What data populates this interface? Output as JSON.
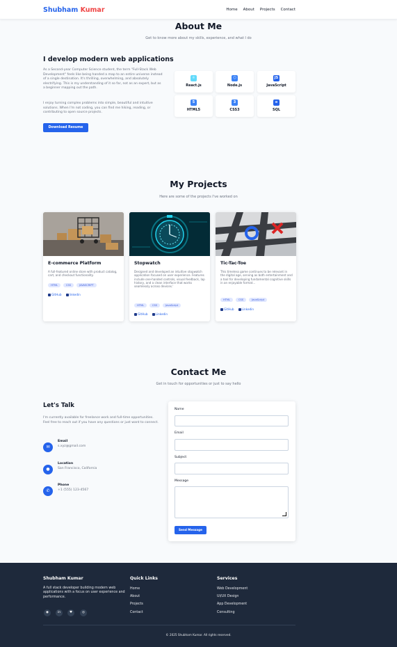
{
  "nav": {
    "logo_first": "Shubham",
    "logo_last": "Kumar",
    "links": [
      "Home",
      "About",
      "Projects",
      "Contact"
    ]
  },
  "about": {
    "title": "About Me",
    "subtitle": "Get to know more about my skills, experience, and what I do",
    "heading": "I develop modern web applications",
    "para1": "As a Second-year Computer Science student, the term \"Full-Stack Web Development\" feels like being handed a map to an entire universe instead of a single destination. It's thrilling, overwhelming, and absolutely electrifying. This is my understanding of it so far, not as an expert, but as a beginner mapping out the path.",
    "para2": "I enjoy turning complex problems into simple, beautiful and intuitive solutions. When I'm not coding, you can find me hiking, reading, or contributing to open source projects.",
    "resume_button": "Download Resume",
    "skills": [
      {
        "name": "React.js",
        "icon": "react-icon",
        "glyph": "⚛",
        "color": "#61dafb"
      },
      {
        "name": "Node.js",
        "icon": "nodejs-icon",
        "glyph": "⬡",
        "color": "#3b82f6"
      },
      {
        "name": "JavaScript",
        "icon": "javascript-icon",
        "glyph": "JS",
        "color": "#2563eb"
      },
      {
        "name": "HTML5",
        "icon": "html5-icon",
        "glyph": "5",
        "color": "#3b82f6"
      },
      {
        "name": "CSS3",
        "icon": "css3-icon",
        "glyph": "3",
        "color": "#3b82f6"
      },
      {
        "name": "SQL",
        "icon": "database-icon",
        "glyph": "≡",
        "color": "#2563eb"
      }
    ]
  },
  "projects": {
    "title": "My Projects",
    "subtitle": "Here are some of the projects I've worked on",
    "items": [
      {
        "title": "E-commerce Platform",
        "desc": "A full-featured online store with product catalog, cart, and checkout functionality.",
        "tags": [
          "HTML",
          "CSS",
          "JAVASCRIPT"
        ],
        "github": "GitHub",
        "linkedin": "linkedin"
      },
      {
        "title": "Stopwatch",
        "desc": "Designed and developed an intuitive stopwatch application focused on user experience. Features include one-handed controls, visual feedback, lap history, and a clean interface that works seamlessly across devices.'",
        "tags": [
          "HTML",
          "CSS",
          "JavaScript"
        ],
        "github": "GitHub",
        "linkedin": "Linkedin"
      },
      {
        "title": "Tic-Tac-Toe",
        "desc": "This timeless game continues to be relevant in the digital age, serving as both entertainment and a tool for developing fundamental cognitive skills in an enjoyable format...",
        "tags": [
          "HTML",
          "CSS",
          "JavaScript"
        ],
        "github": "GitHub",
        "linkedin": "Linkedin"
      }
    ]
  },
  "contact": {
    "title": "Contact Me",
    "subtitle": "Get in touch for opportunities or just to say hello",
    "talk_heading": "Let's Talk",
    "talk_text": "I'm currently available for freelance work and full-time opportunities. Feel free to reach out if you have any questions or just want to connect.",
    "info": [
      {
        "label": "Email",
        "value": "s.xyz@gmail.com",
        "icon": "mail-icon",
        "glyph": "✉"
      },
      {
        "label": "Location",
        "value": "San Francisco, California",
        "icon": "location-pin-icon",
        "glyph": "●"
      },
      {
        "label": "Phone",
        "value": "+1 (555) 123-4567",
        "icon": "phone-icon",
        "glyph": "✆"
      }
    ],
    "form": {
      "name_label": "Name",
      "email_label": "Email",
      "subject_label": "Subject",
      "message_label": "Message",
      "send_button": "Send Message"
    }
  },
  "footer": {
    "brand": "Shubham Kumar",
    "desc": "A full stack developer building modern web applications with a focus on user experience and performance.",
    "social": [
      {
        "icon": "github-icon",
        "glyph": "◉"
      },
      {
        "icon": "linkedin-icon",
        "glyph": "in"
      },
      {
        "icon": "twitter-icon",
        "glyph": "♥"
      },
      {
        "icon": "dribbble-icon",
        "glyph": "◎"
      }
    ],
    "quick_links_title": "Quick Links",
    "quick_links": [
      "Home",
      "About",
      "Projects",
      "Contact"
    ],
    "services_title": "Services",
    "services": [
      "Web Development",
      "UI/UX Design",
      "App Development",
      "Consulting"
    ],
    "copyright": "© 2025 Shubham Kumar. All rights reserved."
  }
}
